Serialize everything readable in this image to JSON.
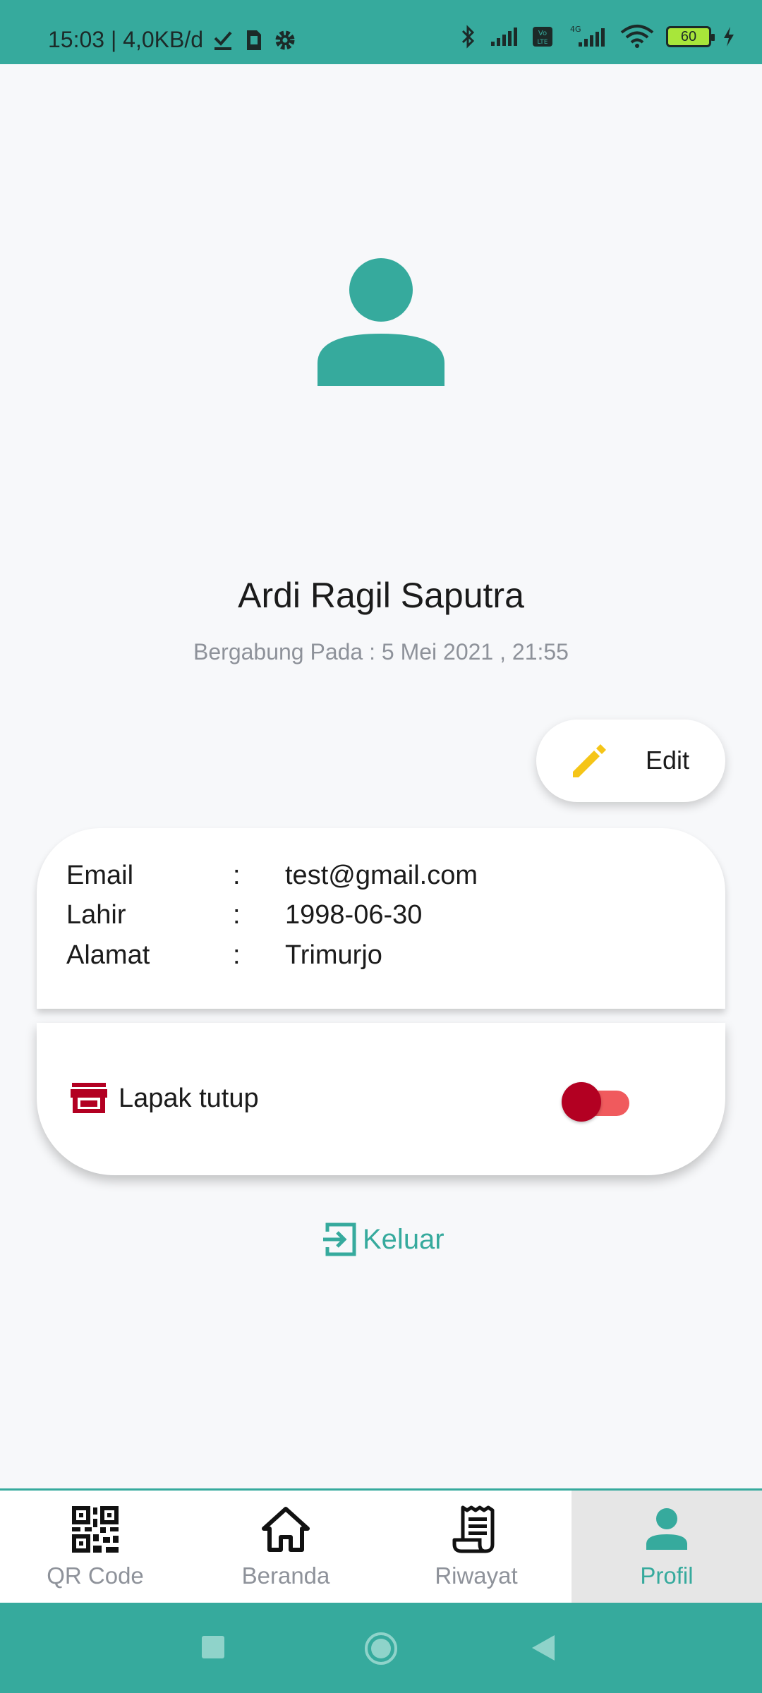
{
  "status_bar": {
    "time_speed": "15:03 | 4,0KB/d",
    "battery_level": "60",
    "icons": [
      "check-icon",
      "sim-icon",
      "gear-icon",
      "bluetooth-icon",
      "signal-icon",
      "volte-icon",
      "4g-signal-icon",
      "wifi-icon",
      "battery-icon",
      "charging-icon"
    ]
  },
  "profile": {
    "name": "Ardi Ragil Saputra",
    "joined": "Bergabung Pada : 5 Mei 2021 , 21:55",
    "edit_label": "Edit"
  },
  "info": {
    "rows": [
      {
        "key": "Email",
        "sep": ":",
        "value": "test@gmail.com"
      },
      {
        "key": "Lahir",
        "sep": ":",
        "value": "1998-06-30"
      },
      {
        "key": "Alamat",
        "sep": ":",
        "value": "Trimurjo"
      }
    ]
  },
  "store": {
    "label": "Lapak tutup",
    "toggle_on": false
  },
  "logout_label": "Keluar",
  "bottom_nav": {
    "items": [
      {
        "label": "QR Code",
        "icon": "qr-code-icon",
        "active": false
      },
      {
        "label": "Beranda",
        "icon": "home-icon",
        "active": false
      },
      {
        "label": "Riwayat",
        "icon": "receipt-icon",
        "active": false
      },
      {
        "label": "Profil",
        "icon": "person-icon",
        "active": true
      }
    ]
  },
  "colors": {
    "primary": "#36aa9d",
    "background": "#f7f8fa",
    "edit_icon": "#f5c518",
    "store_icon": "#b30022",
    "toggle_thumb": "#b30022",
    "toggle_track": "#f05a5d",
    "muted_text": "#8e929a"
  }
}
